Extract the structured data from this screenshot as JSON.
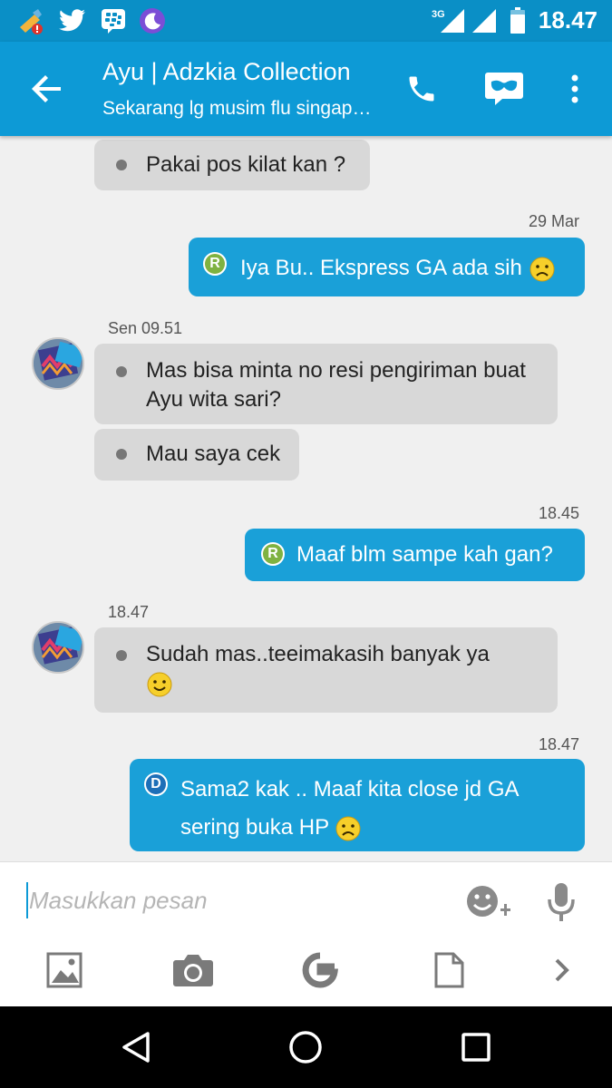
{
  "status_bar": {
    "time": "18.47",
    "network": "3G",
    "icons": [
      "cleaner-icon",
      "twitter-icon",
      "bbm-icon",
      "moon-app-icon",
      "signal-3g-icon",
      "signal-icon",
      "battery-icon"
    ]
  },
  "header": {
    "title": "Ayu | Adzkia Collection",
    "subtitle": "Sekarang lg musim flu singapura",
    "actions": [
      "phone-icon",
      "bbm-video-icon",
      "more-icon"
    ]
  },
  "messages": [
    {
      "dir": "in",
      "text": "Pakai pos kilat kan ?"
    },
    {
      "dir": "out",
      "time": "29 Mar",
      "badge": "R",
      "text": "Iya Bu.. Ekspress GA ada sih",
      "emoji": "sad"
    },
    {
      "dir": "in",
      "time": "Sen 09.51",
      "text": "Mas bisa minta no resi pengiriman buat Ayu wita sari?"
    },
    {
      "dir": "in",
      "text": "Mau saya cek"
    },
    {
      "dir": "out",
      "time": "18.45",
      "badge": "R",
      "text": "Maaf blm sampe kah gan?"
    },
    {
      "dir": "in",
      "time": "18.47",
      "text": "Sudah mas..teeimakasih banyak ya",
      "emoji": "smile"
    },
    {
      "dir": "out",
      "time": "18.47",
      "badge": "D",
      "text": "Sama2 kak .. Maaf kita close jd GA sering buka HP",
      "emoji": "sad"
    }
  ],
  "composer": {
    "placeholder": "Masukkan pesan",
    "tools": [
      "emoji-add-icon",
      "microphone-icon",
      "image-icon",
      "camera-icon",
      "google-icon",
      "document-icon",
      "chevron-right-icon"
    ]
  },
  "colors": {
    "primary": "#0d9ad6",
    "status_bar": "#0a8fc6",
    "bubble_out": "#1aa0d8",
    "bubble_in": "#d8d8d8",
    "badge_r": "#7fb241",
    "badge_d": "#1d6fb8"
  }
}
